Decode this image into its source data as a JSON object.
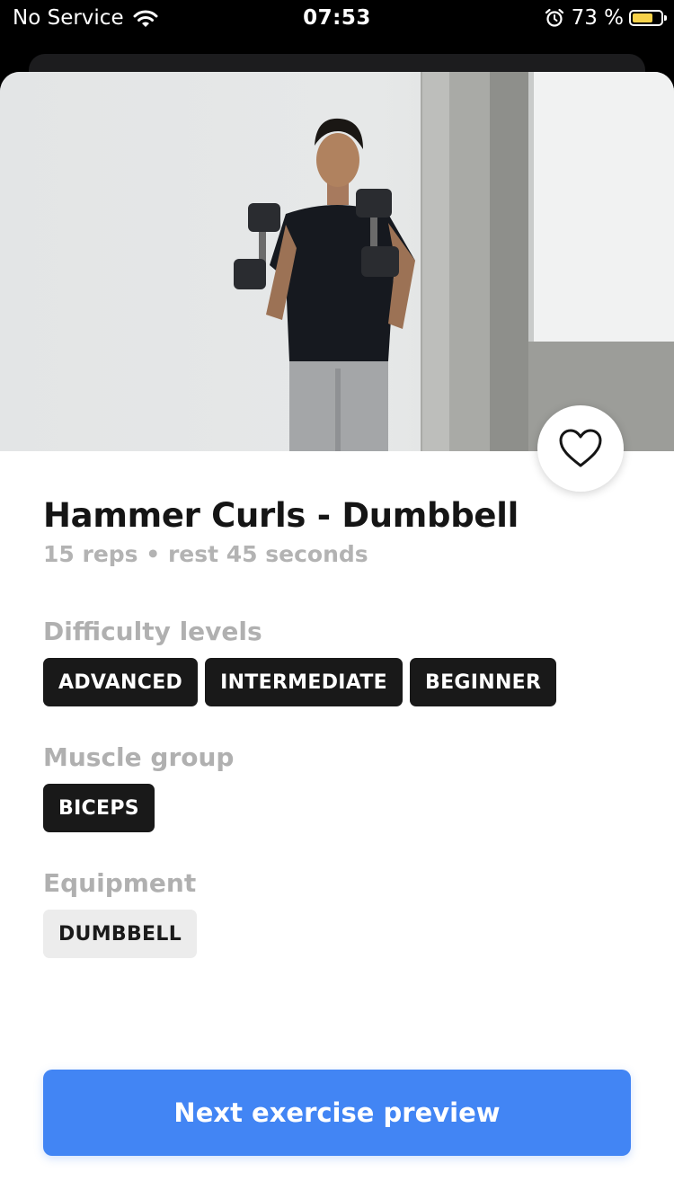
{
  "status_bar": {
    "carrier": "No Service",
    "time": "07:53",
    "battery_percent": "73 %",
    "battery_level": 0.73,
    "battery_color": "#f7d24a",
    "icons": [
      "wifi-icon",
      "alarm-icon",
      "battery-icon"
    ]
  },
  "exercise": {
    "title": "Hammer Curls - Dumbbell",
    "subtitle": "15 reps • rest 45 seconds",
    "favorite_icon": "heart-outline-icon"
  },
  "sections": {
    "difficulty": {
      "label": "Difficulty levels",
      "chips": [
        "ADVANCED",
        "INTERMEDIATE",
        "BEGINNER"
      ]
    },
    "muscle": {
      "label": "Muscle group",
      "chips": [
        "BICEPS"
      ]
    },
    "equipment": {
      "label": "Equipment",
      "chips": [
        "DUMBBELL"
      ]
    }
  },
  "footer": {
    "next_button": "Next exercise preview",
    "accent": "#4285f4"
  }
}
